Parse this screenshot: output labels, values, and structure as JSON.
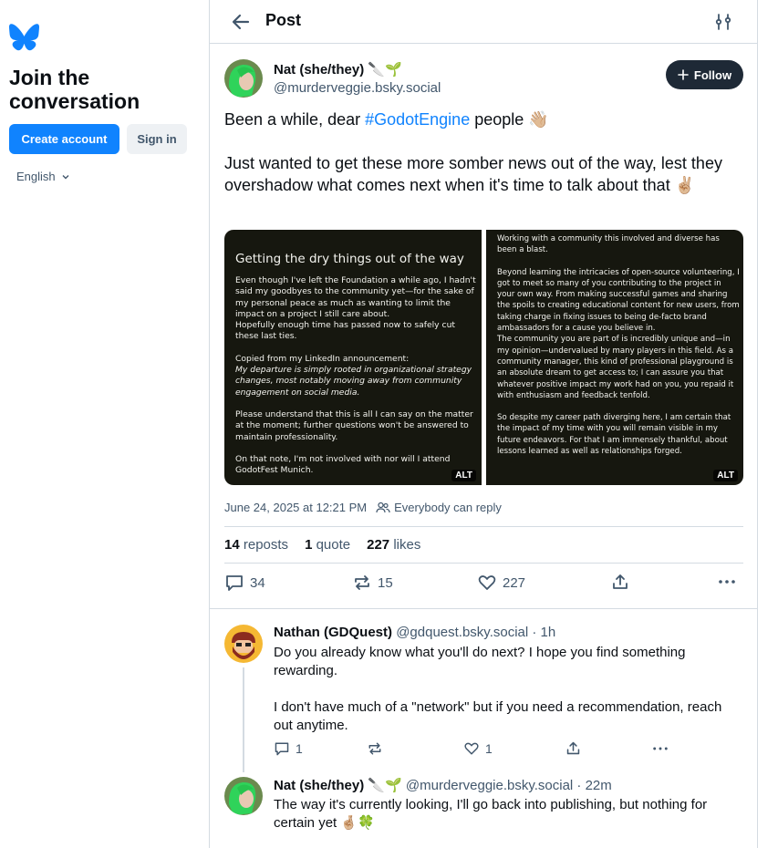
{
  "sidebar": {
    "join_title": "Join the conversation",
    "create_account": "Create account",
    "sign_in": "Sign in",
    "language": "English"
  },
  "header": {
    "title": "Post"
  },
  "post": {
    "author_name": "Nat (she/they) 🔪🌱",
    "author_handle": "@murderveggie.bsky.social",
    "follow_label": "Follow",
    "text_before_tag": "Been a while, dear ",
    "hashtag": "#GodotEngine",
    "text_after_tag": " people 👋🏼",
    "text_para2": "Just wanted to get these more somber news out of the way, lest they overshadow what comes next when it's time to talk about that ✌🏼",
    "image1": {
      "title": "Getting the dry things out of the way",
      "p1": "Even though I've left the Foundation a while ago, I hadn't said my goodbyes to the community yet—for the sake of my personal peace as much as wanting to limit the impact on a project I still care about.",
      "p1b": "Hopefully enough time has passed now to safely cut these last ties.",
      "p2": "Copied from my LinkedIn announcement:",
      "p2i": "My departure is simply rooted in organizational strategy changes, most notably moving away from community engagement on social media.",
      "p3": "Please understand that this is all I can say on the matter at the moment; further questions won't be answered to maintain professionality.",
      "p4": "On that note, I'm not involved with nor will I attend GodotFest Munich.",
      "alt": "ALT"
    },
    "image2": {
      "p1": "Working with a community this involved and diverse has been a blast.",
      "p2": "Beyond learning the intricacies of open-source volunteering, I got to meet so many of you contributing to the project in your own way. From making successful games and sharing the spoils to creating educational content for new users, from taking charge in fixing issues to being de-facto brand ambassadors for a cause you believe in.",
      "p2b": "The community you are part of is incredibly unique and—in my opinion—undervalued by many players in this field. As a community manager, this kind of professional playground is an absolute dream to get access to; I can assure you that whatever positive impact my work had on you, you repaid it with enthusiasm and feedback tenfold.",
      "p3": "So despite my career path diverging here, I am certain that the impact of my time with you will remain visible in my future endeavors. For that I am immensely thankful, about lessons learned as well as relationships forged.",
      "alt": "ALT"
    },
    "timestamp": "June 24, 2025 at 12:21 PM",
    "reply_setting": "Everybody can reply",
    "stats": {
      "reposts_count": "14",
      "reposts_label": "reposts",
      "quotes_count": "1",
      "quotes_label": "quote",
      "likes_count": "227",
      "likes_label": "likes"
    },
    "actions": {
      "replies": "34",
      "reposts": "15",
      "likes": "227"
    }
  },
  "replies": [
    {
      "name": "Nathan (GDQuest)",
      "handle": "@gdquest.bsky.social",
      "time": "· 1h",
      "p1": "Do you already know what you'll do next? I hope you find something rewarding.",
      "p2": "I don't have much of a \"network\" but if you need a recommendation, reach out anytime.",
      "reply_count": "1",
      "like_count": "1"
    },
    {
      "name": "Nat (she/they) 🔪🌱",
      "handle": "@murderveggie.bsky.social",
      "time": "· 22m",
      "p1": "The way it's currently looking, I'll go back into publishing, but nothing for certain yet 🤞🏼🍀"
    }
  ],
  "colors": {
    "accent": "#1083fe",
    "follow_bg": "#1e2936",
    "muted": "#42576c",
    "border": "#d4dbe2"
  }
}
